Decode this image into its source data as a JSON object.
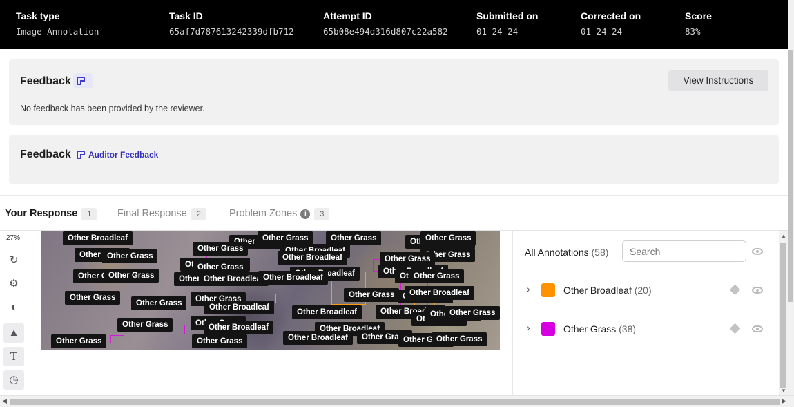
{
  "header": {
    "columns": [
      {
        "label": "Task type",
        "value": "Image Annotation"
      },
      {
        "label": "Task ID",
        "value": "65af7d787613242339dfb712"
      },
      {
        "label": "Attempt ID",
        "value": "65b08e494d316d807c22a582"
      },
      {
        "label": "Submitted on",
        "value": "01-24-24"
      },
      {
        "label": "Corrected on",
        "value": "01-24-24"
      },
      {
        "label": "Score",
        "value": "83%"
      }
    ]
  },
  "feedback": {
    "title": "Feedback",
    "message": "No feedback has been provided by the reviewer.",
    "view_instructions_label": "View Instructions"
  },
  "auditor_feedback": {
    "title": "Feedback",
    "link_label": "Auditor Feedback"
  },
  "tabs": [
    {
      "label": "Your Response",
      "count": "1"
    },
    {
      "label": "Final Response",
      "count": "2"
    },
    {
      "label": "Problem Zones",
      "count": "3"
    }
  ],
  "toolbar": {
    "zoom": "27%",
    "icons": [
      "refresh-icon",
      "settings-icon",
      "contrast-icon",
      "shapes-icon",
      "text-icon",
      "history-icon"
    ]
  },
  "canvas_labels": {
    "broadleaf": "Other Broadleaf",
    "grass": "Other Grass"
  },
  "annotations_panel": {
    "title": "All Annotations",
    "count": "(58)",
    "search_placeholder": "Search",
    "classes": [
      {
        "name": "Other Broadleaf",
        "count": "(20)",
        "color": "#ff9200"
      },
      {
        "name": "Other Grass",
        "count": "(38)",
        "color": "#d600e0"
      }
    ]
  }
}
